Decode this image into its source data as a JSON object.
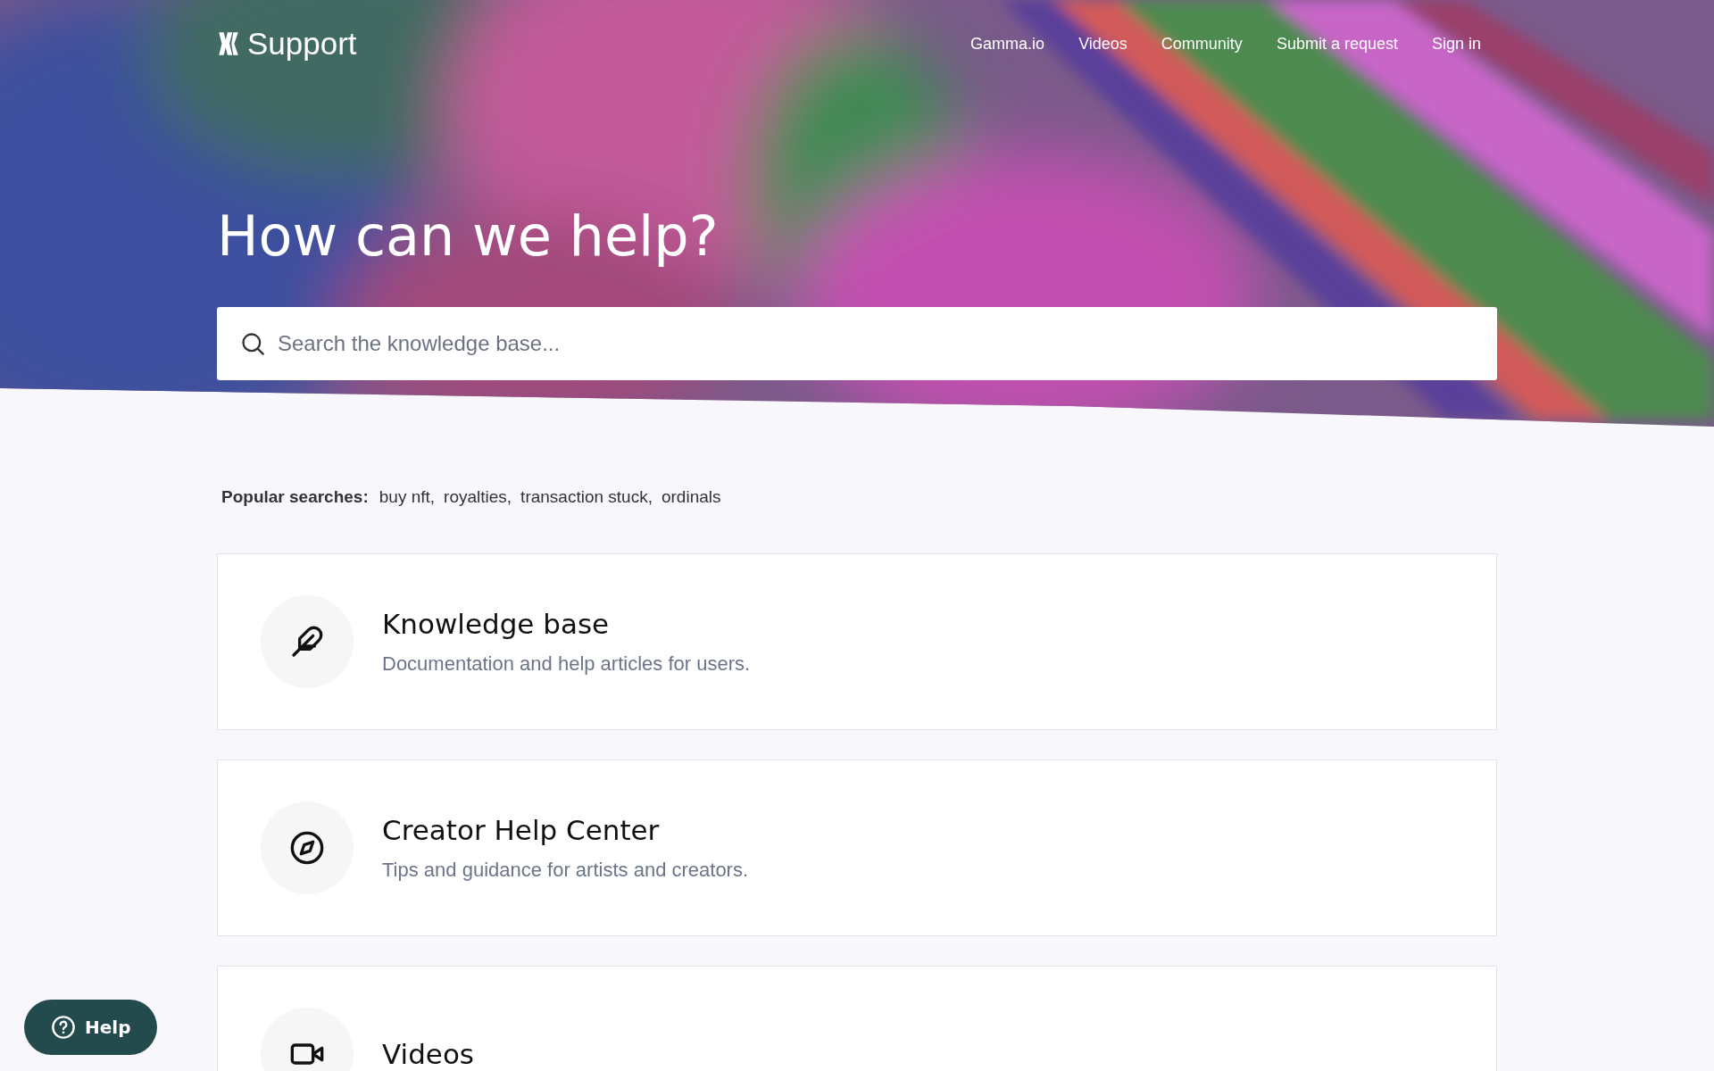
{
  "header": {
    "logo_text": "Support",
    "nav": [
      {
        "label": "Gamma.io"
      },
      {
        "label": "Videos"
      },
      {
        "label": "Community"
      },
      {
        "label": "Submit a request"
      },
      {
        "label": "Sign in"
      }
    ]
  },
  "hero": {
    "heading": "How can we help?"
  },
  "search": {
    "placeholder": "Search the knowledge base..."
  },
  "popular_searches": {
    "label": "Popular searches:",
    "items": [
      "buy nft,",
      "royalties,",
      "transaction stuck,",
      "ordinals"
    ]
  },
  "categories": [
    {
      "title": "Knowledge base",
      "description": "Documentation and help articles for users."
    },
    {
      "title": "Creator Help Center",
      "description": "Tips and guidance for artists and creators."
    },
    {
      "title": "Videos"
    }
  ],
  "help_button": {
    "label": "Help"
  }
}
